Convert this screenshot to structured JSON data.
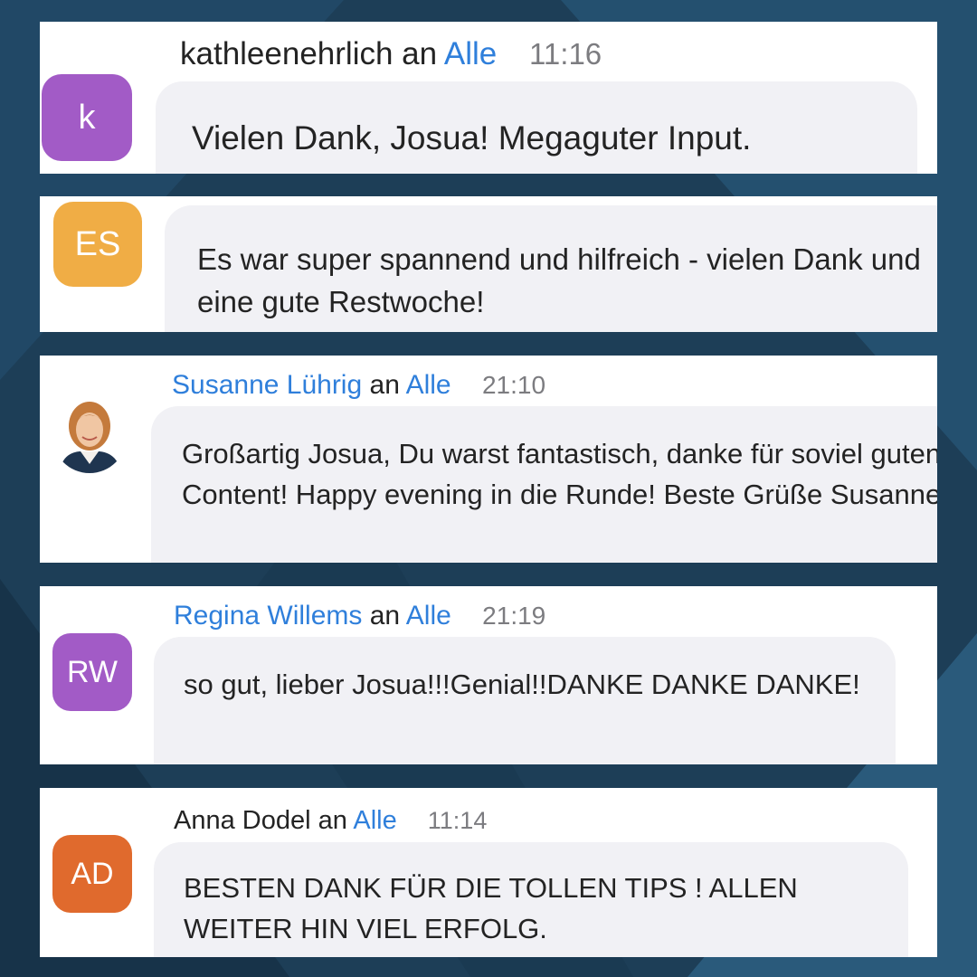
{
  "colors": {
    "background": "#1d3e57",
    "link_blue": "#2f7fdb",
    "bubble": "#f1f1f5",
    "avatar_purple": "#a25bc6",
    "avatar_orange": "#f0ad45",
    "avatar_red_orange": "#e06a2d"
  },
  "messages": [
    {
      "sender": "kathleenehrlich",
      "connector": "an",
      "recipient": "Alle",
      "time": "11:16",
      "avatar_text": "k",
      "text": "Vielen Dank, Josua! Megaguter Input."
    },
    {
      "avatar_text": "ES",
      "text": "Es war super spannend und hilfreich - vielen Dank und eine gute Restwoche!"
    },
    {
      "sender": "Susanne Lührig",
      "connector": "an",
      "recipient": "Alle",
      "time": "21:10",
      "avatar_icon": "profile-photo",
      "text": "Großartig Josua, Du warst fantastisch, danke für soviel guten Content! Happy evening in die Runde! Beste Grüße Susanne"
    },
    {
      "sender": "Regina Willems",
      "connector": "an",
      "recipient": "Alle",
      "time": "21:19",
      "avatar_text": "RW",
      "text": "so gut, lieber Josua!!!Genial!!DANKE DANKE DANKE!"
    },
    {
      "sender": "Anna Dodel",
      "connector": "an",
      "recipient": "Alle",
      "time": "11:14",
      "avatar_text": "AD",
      "text": "BESTEN DANK FÜR DIE TOLLEN TIPS ! ALLEN WEITER HIN VIEL ERFOLG."
    }
  ]
}
